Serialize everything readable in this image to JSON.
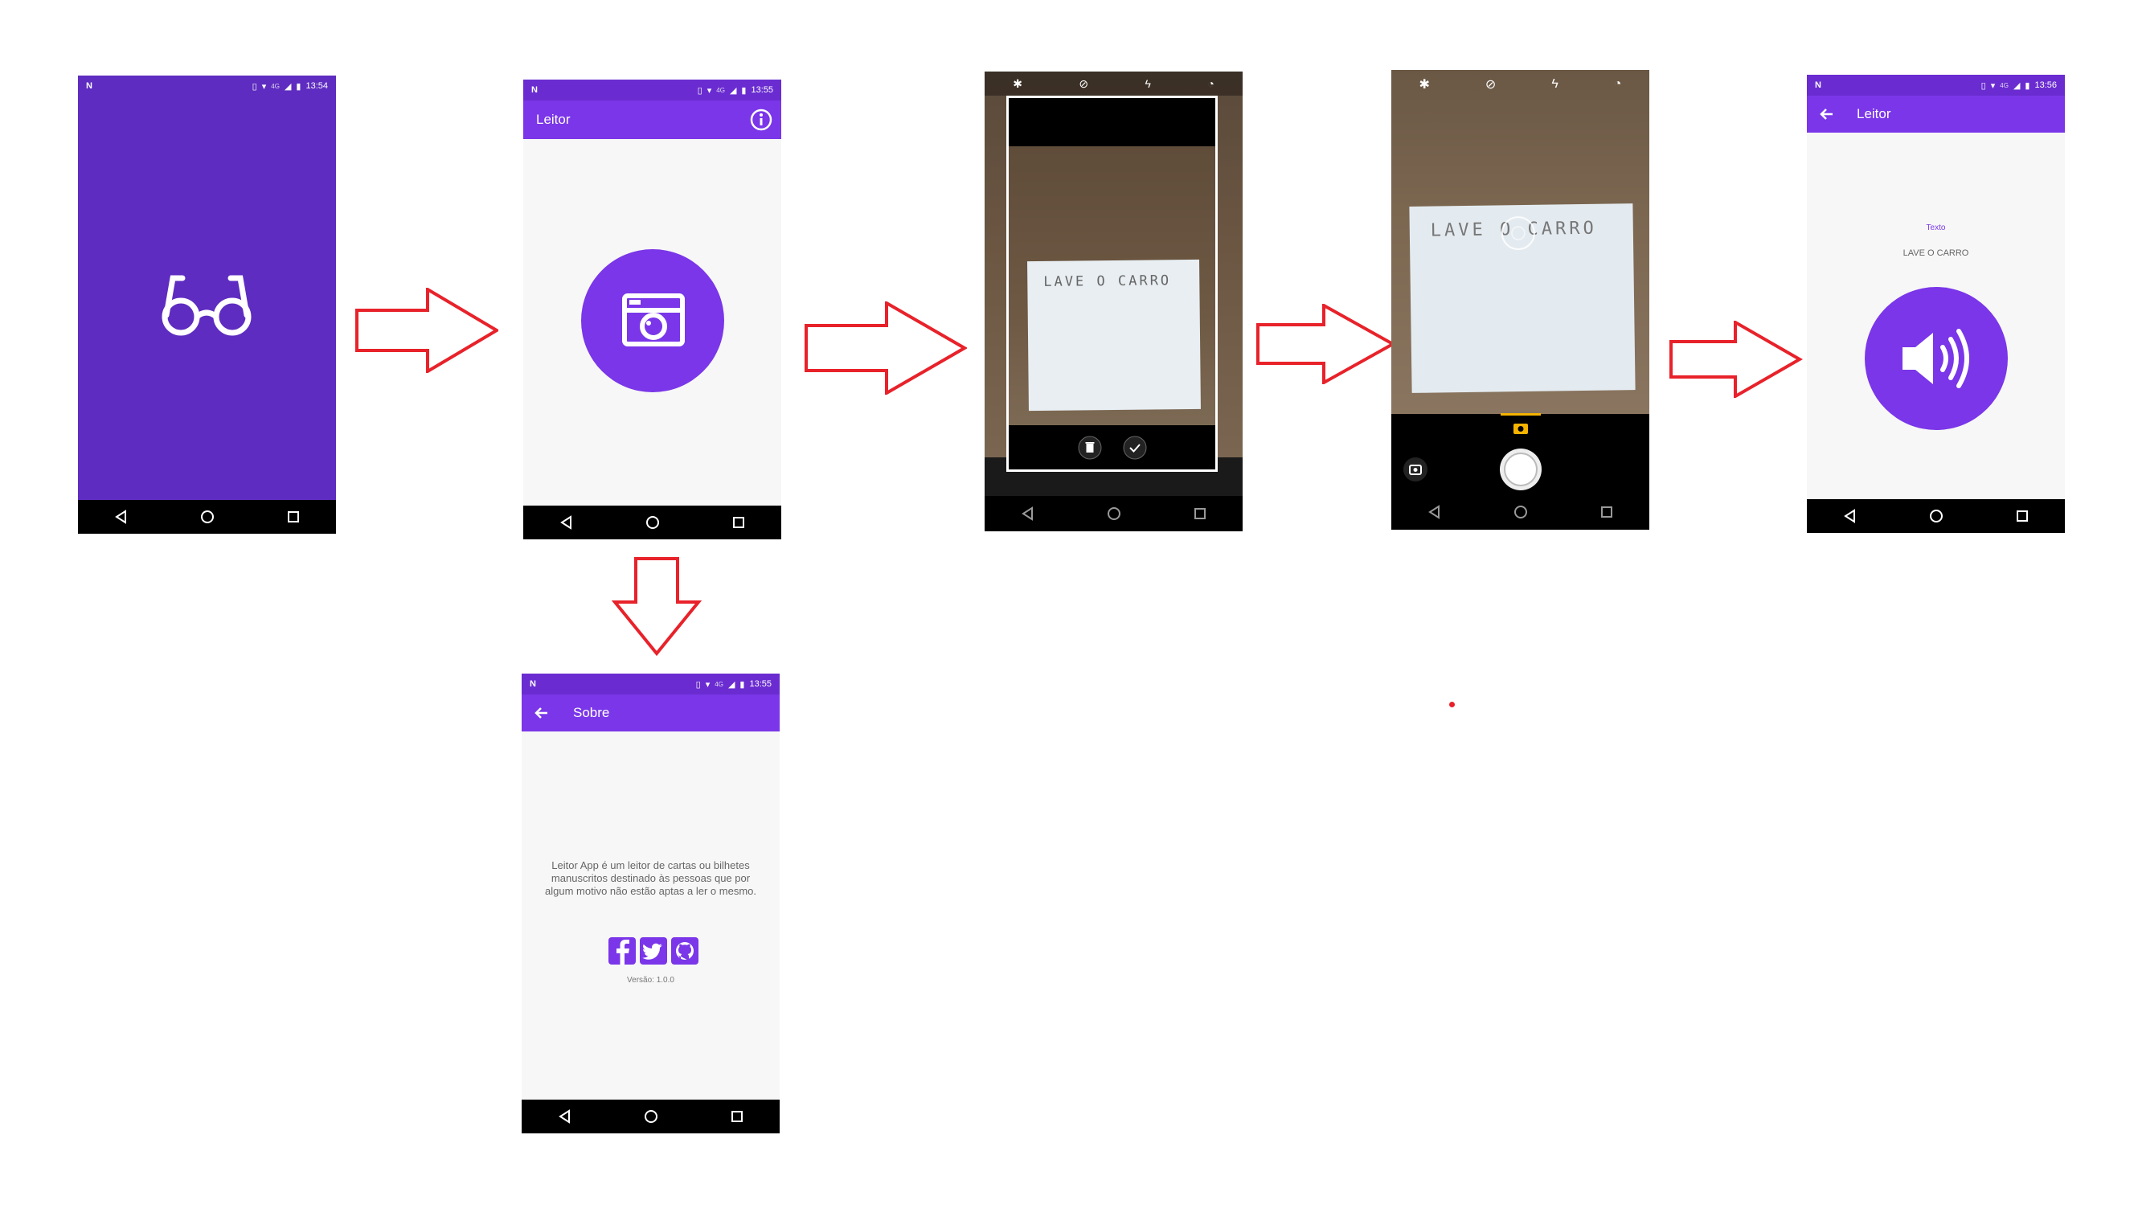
{
  "screens": {
    "splash": {
      "status": {
        "carrier_icon": "N",
        "network": "4G",
        "time": "13:54"
      },
      "logo_icon": "glasses-icon",
      "color": "#5e2cc0"
    },
    "main": {
      "status": {
        "carrier_icon": "N",
        "network": "4G",
        "time": "13:55"
      },
      "title": "Leitor",
      "info_icon": "info-icon",
      "camera_button_icon": "camera-icon",
      "accent": "#7a36e8"
    },
    "about": {
      "status": {
        "carrier_icon": "N",
        "network": "4G",
        "time": "13:55"
      },
      "title": "Sobre",
      "description": "Leitor App é um leitor de cartas ou bilhetes manuscritos destinado às pessoas que por algum motivo não estão aptas a ler o mesmo.",
      "social": [
        "facebook-icon",
        "twitter-icon",
        "github-icon"
      ],
      "version": "Versão: 1.0.0"
    },
    "camera_review": {
      "note_text": "LAVE O CARRO",
      "actions": [
        "trash-icon",
        "check-icon"
      ]
    },
    "camera_capture": {
      "note_text": "LAVE O CARRO",
      "top_icons": [
        "settings-icon",
        "hdr-off-icon",
        "flash-off-icon",
        "timer-off-icon"
      ]
    },
    "result": {
      "status": {
        "carrier_icon": "N",
        "network": "4G",
        "time": "13:56"
      },
      "title": "Leitor",
      "label": "Texto",
      "recognized_text": "LAVE O CARRO",
      "speaker_icon": "speaker-icon"
    }
  },
  "colors": {
    "arrow": "#e8222a",
    "purple": "#7a36e8",
    "splash": "#5e2cc0"
  }
}
